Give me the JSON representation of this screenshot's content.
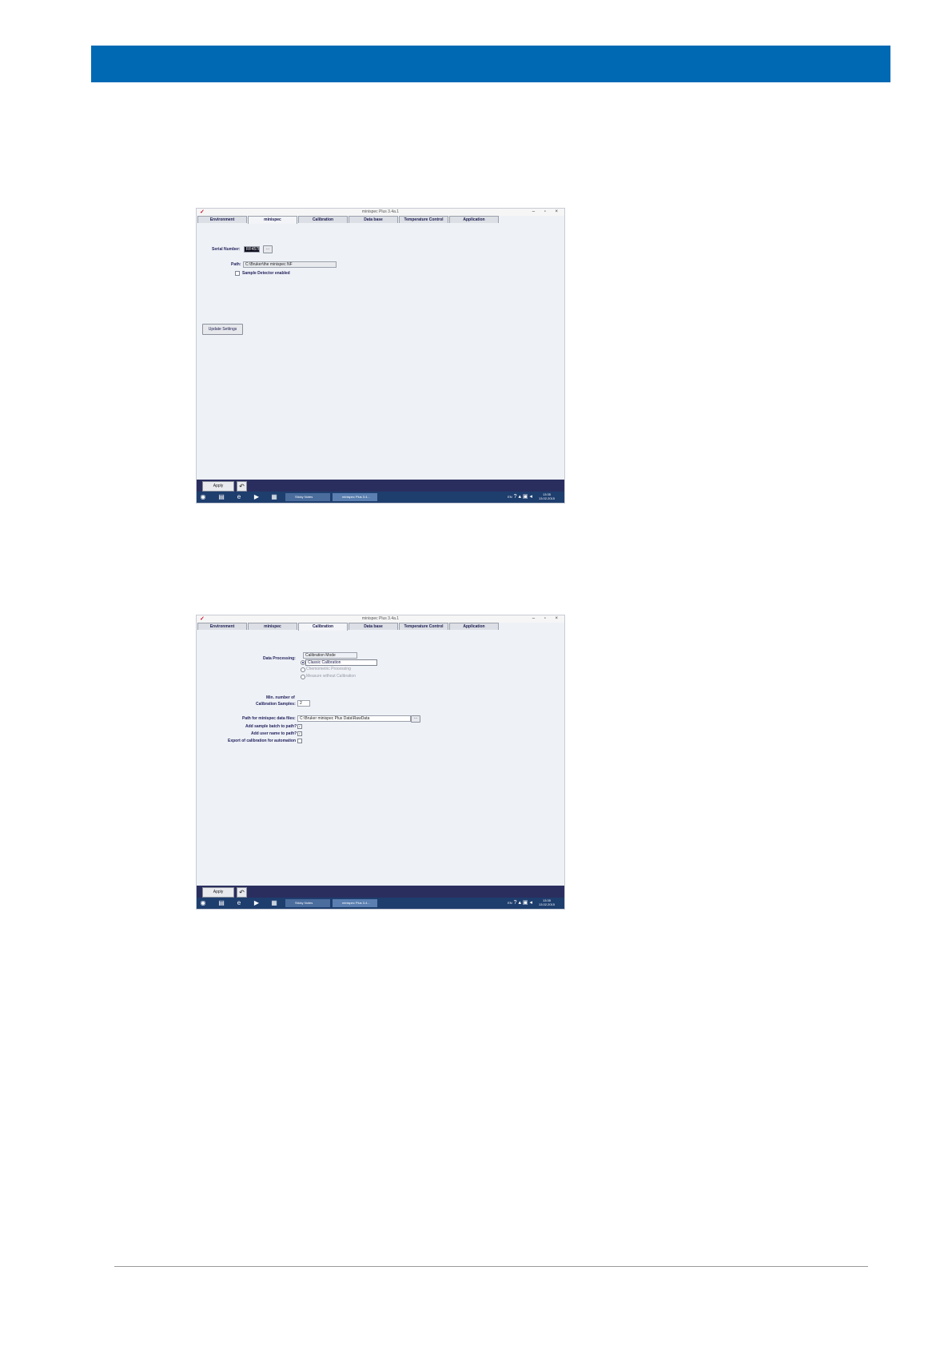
{
  "screens": [
    {
      "window_title": "minispec Plus 3.4a.1",
      "tabs": [
        "Environment",
        "minispec",
        "Calibration",
        "Data base",
        "Temperature Control",
        "Application"
      ],
      "active_tab": "minispec",
      "serial_number_label": "Serial Number:",
      "serial_number_value": "RF4578",
      "browse_label": "...",
      "path_label": "Path:",
      "path_value": "C:\\Bruker\\the minispec NF",
      "sample_detector_label": "Sample Detector enabled",
      "update_button": "Update Settings",
      "apply_button": "Apply",
      "undo_icon": "undo-icon",
      "task_sticky": "Sticky Notes",
      "task_app": "minispec Plus 3.4...",
      "lang": "EN",
      "time": "13:35",
      "date": "13.02.2015"
    },
    {
      "window_title": "minispec Plus 3.4a.1",
      "tabs": [
        "Environment",
        "minispec",
        "Calibration",
        "Data base",
        "Temperature Control",
        "Application"
      ],
      "active_tab": "Calibration",
      "data_processing_label": "Data Processing:",
      "calibration_mode": "Calibration Mode",
      "option_classic": "Classic Calibration",
      "option_chemometric": "Chemometric Processing",
      "option_measure": "Measure without Calibration",
      "min_samples_label_1": "Min. number of",
      "min_samples_label_2": "Calibration Samples:",
      "min_samples_value": "2",
      "data_files_path_label": "Path for minispec data files:",
      "data_files_path_value": "C:\\Bruker minispec Plus Data\\RawData",
      "browse_label": "...",
      "add_batch_label": "Add sample batch to path?",
      "add_user_label": "Add user name to path?",
      "export_label": "Export of calibration for automation",
      "check_mark": "✓",
      "apply_button": "Apply",
      "task_sticky": "Sticky Notes",
      "task_app": "minispec Plus 3.4...",
      "lang": "EN",
      "time": "13:35",
      "date": "13.02.2015"
    }
  ]
}
